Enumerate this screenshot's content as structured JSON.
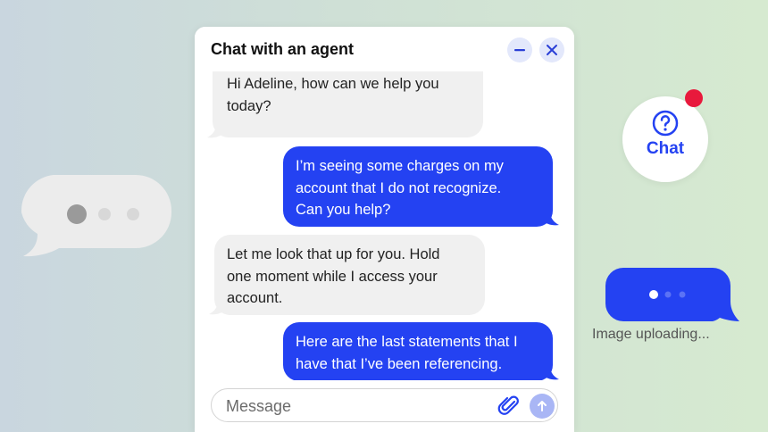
{
  "chat": {
    "title": "Chat with an agent",
    "minimize_icon": "minus-icon",
    "close_icon": "close-icon",
    "messages": [
      {
        "sender": "agent",
        "lines": [
          "Hi Adeline, how can we help you",
          "today?"
        ]
      },
      {
        "sender": "user",
        "lines": [
          "I’m seeing some charges on my",
          "account that I do not recognize.",
          "Can you help?"
        ]
      },
      {
        "sender": "agent",
        "lines": [
          "Let me look that up for you. Hold",
          "one moment while I access your",
          "account."
        ]
      },
      {
        "sender": "user",
        "lines": [
          "Here are the last statements that I",
          "have that I’ve been referencing."
        ]
      }
    ],
    "composer": {
      "placeholder": "Message",
      "attach_icon": "paperclip-icon",
      "send_icon": "arrow-up-icon"
    }
  },
  "launcher": {
    "label": "Chat",
    "icon": "help-circle-icon",
    "notification": true
  },
  "upload_status": {
    "text": "Image uploading..."
  },
  "colors": {
    "accent": "#2442f2",
    "agent_bubble": "#f0f0f0",
    "notification": "#e8193c",
    "send_disabled": "#a9b6f5"
  }
}
